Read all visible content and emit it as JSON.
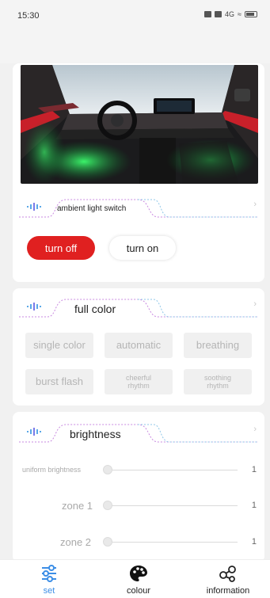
{
  "status_bar": {
    "time": "15:30",
    "signal": "4G"
  },
  "light_switch": {
    "title": "ambient light switch",
    "off_label": "turn off",
    "on_label": "turn on",
    "active": "turn off",
    "active_color": "#e02020"
  },
  "full_color": {
    "title": "full color",
    "modes": [
      "single color",
      "automatic",
      "breathing",
      "burst flash",
      "cheerful rhythm",
      "soothing rhythm"
    ]
  },
  "brightness": {
    "title": "brightness",
    "sliders": [
      {
        "label": "uniform brightness",
        "value": "1"
      },
      {
        "label": "zone 1",
        "value": "1"
      },
      {
        "label": "zone 2",
        "value": "1"
      }
    ]
  },
  "nav": {
    "items": [
      {
        "label": "set",
        "icon": "sliders-icon",
        "active": true
      },
      {
        "label": "colour",
        "icon": "palette-icon",
        "active": false
      },
      {
        "label": "information",
        "icon": "share-nodes-icon",
        "active": false
      }
    ],
    "active_color": "#3c8ee6"
  }
}
